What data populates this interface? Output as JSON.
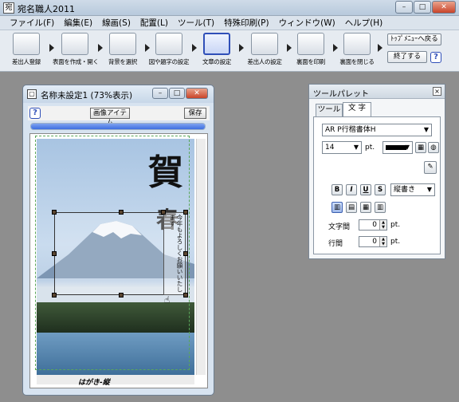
{
  "app": {
    "title": "宛名職人2011",
    "icon_glyph": "宛"
  },
  "window_controls": {
    "minimize": "–",
    "maximize": "□",
    "close": "✕"
  },
  "menu": [
    "ファイル(F)",
    "編集(E)",
    "線画(S)",
    "配置(L)",
    "ツール(T)",
    "特殊印刷(P)",
    "ウィンドウ(W)",
    "ヘルプ(H)"
  ],
  "toolbar": {
    "buttons": [
      "差出人登録",
      "表面を作成・開く",
      "背景を選択",
      "図や題字の設定",
      "文章の設定",
      "差出人の設定",
      "裏面を印刷",
      "裏面を閉じる"
    ],
    "active_index": 4,
    "top_menu_label": "ﾄｯﾌﾟﾒﾆｭｰへ戻る",
    "exit_label": "終了する",
    "help_label": "?"
  },
  "doc": {
    "title": "名称未設定1 (73%表示)",
    "help_label": "?",
    "image_item_label": "画像アイテム",
    "save_label": "保存",
    "progress_fraction": 1.0,
    "caption": "はがき-縦",
    "kanji_main": "賀",
    "kanji_sub": "春",
    "vertical_text": "今年もよろしくお願いいたします"
  },
  "palette": {
    "title": "ツールパレット",
    "tabs": [
      "ツール",
      "文 字"
    ],
    "active_tab": 1,
    "font": "AR P行楷書体H",
    "font_size": "14",
    "size_unit": "pt.",
    "color_value": "#000000",
    "style_buttons": [
      "B",
      "I",
      "U",
      "S"
    ],
    "direction": "縦書き",
    "align_buttons": [
      "▥",
      "▤",
      "▦",
      "▥"
    ],
    "active_align": 0,
    "char_spacing_label": "文字間",
    "char_spacing_value": "0",
    "line_spacing_label": "行間",
    "line_spacing_value": "0",
    "unit": "pt."
  }
}
